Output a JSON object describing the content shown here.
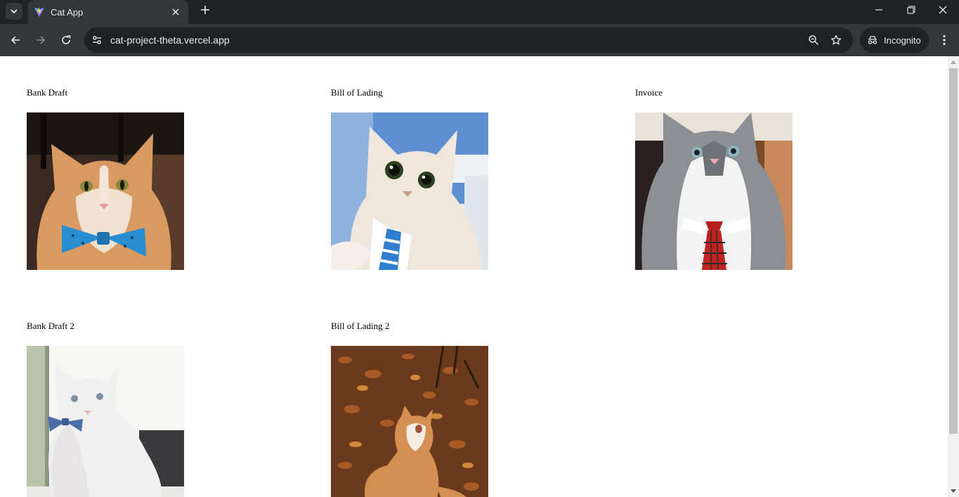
{
  "browser": {
    "tab_title": "Cat App",
    "url": "cat-project-theta.vercel.app",
    "incognito_label": "Incognito"
  },
  "cards": [
    {
      "label": "Bank Draft",
      "image": "orange-white-cat-blue-bowtie"
    },
    {
      "label": "Bill of Lading",
      "image": "cream-cat-blue-striped-tie"
    },
    {
      "label": "Invoice",
      "image": "grey-white-fluffy-cat-red-plaid-tie"
    },
    {
      "label": "Bank Draft 2",
      "image": "white-cat-blue-bowtie-sitting"
    },
    {
      "label": "Bill of Lading 2",
      "image": "orange-cat-in-autumn-leaves"
    }
  ],
  "colors": {
    "chrome_dark": "#202124",
    "chrome_mid": "#35363a",
    "page_bg": "#ffffff"
  }
}
